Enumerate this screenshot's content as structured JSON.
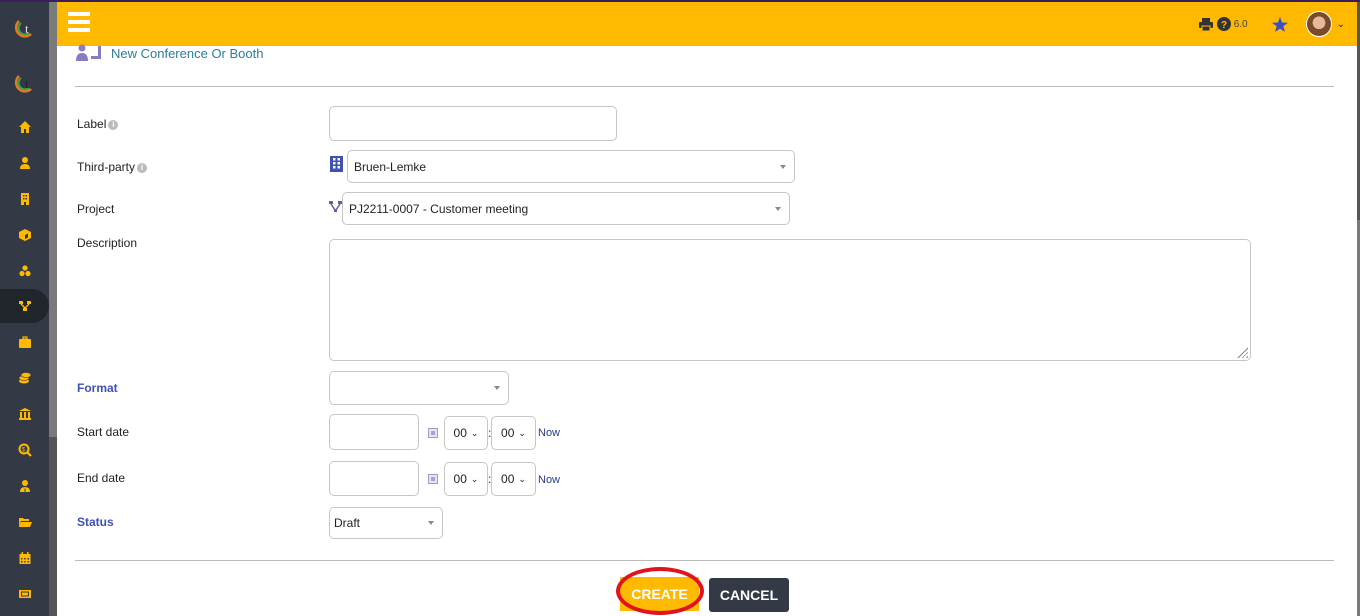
{
  "header": {
    "version": "6.0",
    "icons": [
      "menu-icon",
      "print-icon",
      "help-icon",
      "star-icon",
      "user-avatar",
      "chevron-down-icon"
    ]
  },
  "sidebar": {
    "items": [
      {
        "name": "home",
        "icon": "home-icon"
      },
      {
        "name": "users",
        "icon": "user-icon"
      },
      {
        "name": "companies",
        "icon": "building-icon"
      },
      {
        "name": "products",
        "icon": "cube-icon"
      },
      {
        "name": "stock",
        "icon": "cubes-icon"
      },
      {
        "name": "projects",
        "icon": "project-icon",
        "active": true
      },
      {
        "name": "commercial",
        "icon": "briefcase-icon"
      },
      {
        "name": "billing",
        "icon": "coins-icon"
      },
      {
        "name": "bank",
        "icon": "bank-icon"
      },
      {
        "name": "accounting",
        "icon": "search-dollar-icon"
      },
      {
        "name": "hrm",
        "icon": "user-tie-icon"
      },
      {
        "name": "documents",
        "icon": "folder-open-icon"
      },
      {
        "name": "agenda",
        "icon": "calendar-icon"
      },
      {
        "name": "tickets",
        "icon": "ticket-icon"
      }
    ]
  },
  "page": {
    "title": "New Conference Or Booth"
  },
  "form": {
    "label": {
      "label": "Label",
      "value": ""
    },
    "thirdparty": {
      "label": "Third-party",
      "value": "Bruen-Lemke"
    },
    "project": {
      "label": "Project",
      "value": "PJ2211-0007 - Customer meeting"
    },
    "description": {
      "label": "Description",
      "value": ""
    },
    "format": {
      "label": "Format",
      "value": ""
    },
    "start_date": {
      "label": "Start date",
      "value": "",
      "hour": "00",
      "minute": "00",
      "now_label": "Now"
    },
    "end_date": {
      "label": "End date",
      "value": "",
      "hour": "00",
      "minute": "00",
      "now_label": "Now"
    },
    "status": {
      "label": "Status",
      "value": "Draft"
    },
    "time_separator": ":"
  },
  "actions": {
    "create": "CREATE",
    "cancel": "CANCEL"
  }
}
